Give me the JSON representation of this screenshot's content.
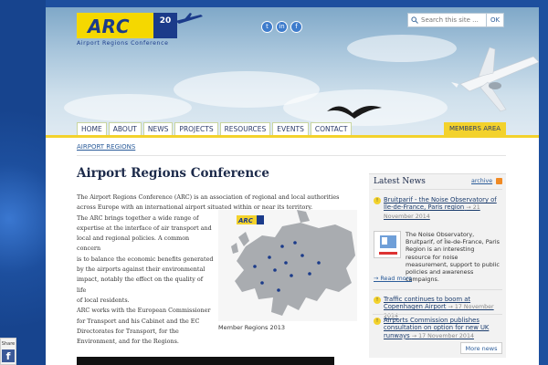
{
  "header": {
    "logo_text": "ARC",
    "logo_badge": "20",
    "logo_tagline": "Airport Regions Conference",
    "social_icons": [
      "twitter-icon",
      "linkedin-icon",
      "facebook-icon"
    ],
    "search": {
      "placeholder": "Search this site ...",
      "ok_label": "OK"
    }
  },
  "nav": {
    "tabs": [
      "HOME",
      "ABOUT",
      "NEWS",
      "PROJECTS",
      "RESOURCES",
      "EVENTS",
      "CONTACT"
    ],
    "members_label": "MEMBERS AREA"
  },
  "breadcrumb": "AIRPORT REGIONS",
  "main": {
    "title": "Airport Regions Conference",
    "para1": "The Airport Regions Conference (ARC) is an association of regional and local authorities across Europe with an international airport situated within or near its territory.",
    "para2_lines": [
      "The ARC brings together a wide range of",
      "expertise at the interface of air transport and",
      "local and regional policies. A common concern",
      "is to balance the economic benefits generated",
      "by the airports against their environmental",
      "impact, notably the effect on the quality of life",
      "of local residents.",
      "ARC works with the European Commissioner",
      "for Transport and his Cabinet and the EC",
      "Directorates for Transport, for the",
      "Environment, and for the Regions."
    ],
    "map_caption": "Member Regions 2013",
    "map_logo": "ARC"
  },
  "news": {
    "title": "Latest News",
    "archive_label": "archive",
    "items": [
      {
        "headline": "Bruitparif - the Noise Observatory of Île-de-France, Paris region",
        "date": "→ 21 November 2014"
      },
      {
        "headline": "Traffic continues to boom at Copenhagen Airport",
        "date": "→ 17 November 2014"
      },
      {
        "headline": "Airports Commission publishes consultation on option for new UK runways",
        "date": "→ 17 November 2014"
      }
    ],
    "body": "The Noise Observatory, Bruitparif, of Île-de-France, Paris Region is an interesting resource for noise measurement, support to public policies and awareness campaigns.",
    "read_more": "→ Read more",
    "more_news": "More news"
  },
  "share": {
    "label": "Share",
    "fb": "f"
  },
  "colors": {
    "accent_yellow": "#f3d22c",
    "brand_blue": "#1b3b8a",
    "link_blue": "#2b5c9a"
  }
}
